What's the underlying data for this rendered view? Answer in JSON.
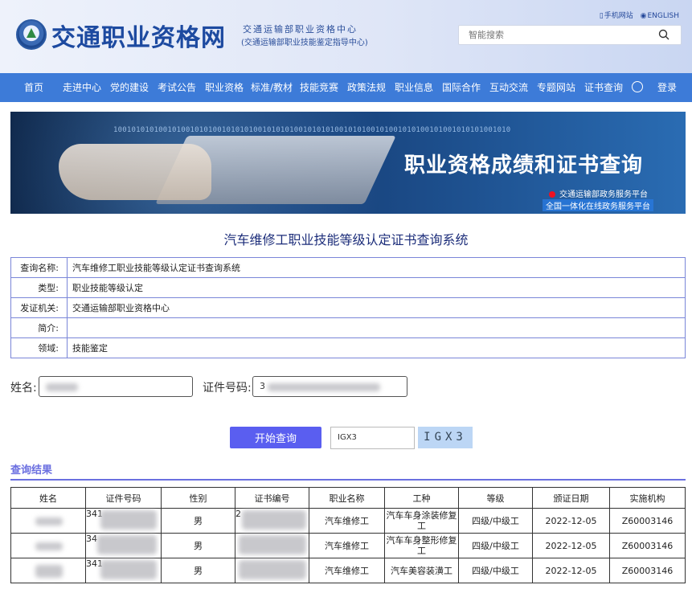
{
  "header": {
    "title": "交通职业资格网",
    "sub1": "交通运输部职业资格中心",
    "sub2": "(交通运输部职业技能鉴定指导中心)",
    "mobile_link": "手机网站",
    "english_link": "ENGLISH",
    "search_placeholder": "智能搜索"
  },
  "nav": [
    "首页",
    "走进中心",
    "党的建设",
    "考试公告",
    "职业资格",
    "标准/教材",
    "技能竞赛",
    "政策法规",
    "职业信息",
    "国际合作",
    "互动交流",
    "专题网站",
    "证书查询",
    "登录"
  ],
  "banner": {
    "binary": "1001010101001010010101001010101001010101001010101001010100101001010100101001010101001010",
    "title": "职业资格成绩和证书查询",
    "line1": "交通运输部政务服务平台",
    "line2": "全国一体化在线政务服务平台"
  },
  "system_title": "汽车维修工职业技能等级认定证书查询系统",
  "info": [
    {
      "k": "查询名称:",
      "v": "汽车维修工职业技能等级认定证书查询系统"
    },
    {
      "k": "类型:",
      "v": "职业技能等级认定"
    },
    {
      "k": "发证机关:",
      "v": "交通运输部职业资格中心"
    },
    {
      "k": "简介:",
      "v": ""
    },
    {
      "k": "领域:",
      "v": "技能鉴定"
    }
  ],
  "form": {
    "name_label": "姓名:",
    "id_label": "证件号码:",
    "id_prefix": "3",
    "query_button": "开始查询",
    "captcha_input": "IGX3",
    "captcha_text": "IGX3"
  },
  "result_title": "查询结果",
  "table": {
    "headers": [
      "姓名",
      "证件号码",
      "性别",
      "证书编号",
      "职业名称",
      "工种",
      "等级",
      "颁证日期",
      "实施机构"
    ],
    "rows": [
      {
        "id": "341",
        "gender": "男",
        "cert": "2",
        "occupation": "汽车维修工",
        "work": "汽车车身涂装修复工",
        "level": "四级/中级工",
        "date": "2022-12-05",
        "org": "Z60003146"
      },
      {
        "id": "34",
        "gender": "男",
        "cert": "",
        "occupation": "汽车维修工",
        "work": "汽车车身整形修复工",
        "level": "四级/中级工",
        "date": "2022-12-05",
        "org": "Z60003146"
      },
      {
        "id": "341",
        "gender": "男",
        "cert": "",
        "occupation": "汽车维修工",
        "work": "汽车美容装潢工",
        "level": "四级/中级工",
        "date": "2022-12-05",
        "org": "Z60003146"
      }
    ]
  },
  "colors": {
    "nav": "#3d7bd8",
    "accent": "#5a5ef0",
    "title": "#1d4aa0"
  }
}
